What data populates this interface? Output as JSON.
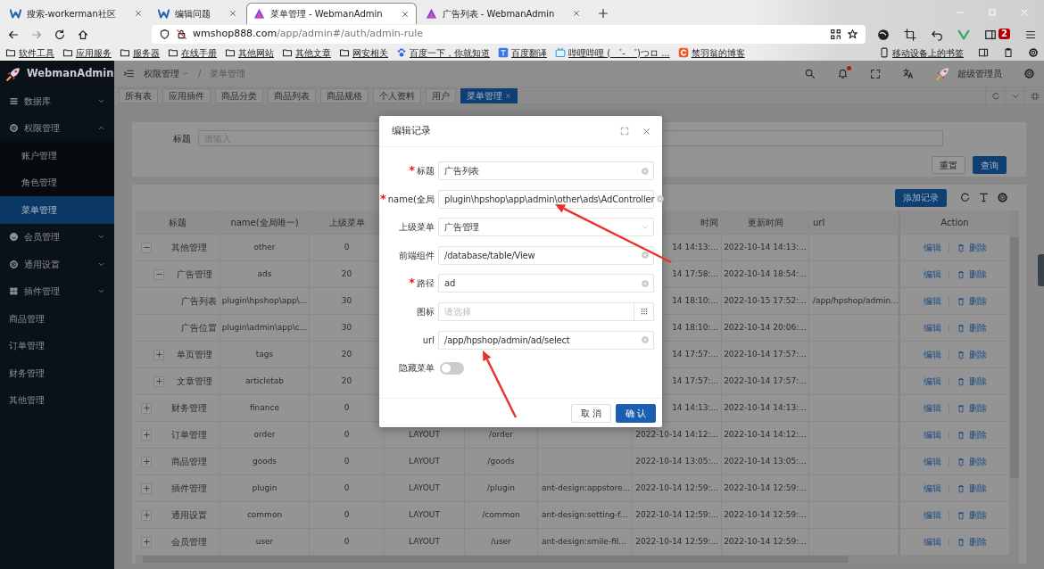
{
  "browser": {
    "tabs": [
      {
        "label": "搜索-workerman社区",
        "selected": false
      },
      {
        "label": "编辑问题",
        "selected": false
      },
      {
        "label": "菜单管理 - WebmanAdmin",
        "selected": true
      },
      {
        "label": "广告列表 - WebmanAdmin",
        "selected": false
      }
    ],
    "address": {
      "host": "wmshop888.com",
      "path": "/app/admin#/auth/admin-rule"
    },
    "extension_badge": "2",
    "bookmarks": [
      {
        "kind": "folder",
        "label": "软件工具"
      },
      {
        "kind": "folder",
        "label": "应用服务"
      },
      {
        "kind": "folder",
        "label": "服务器"
      },
      {
        "kind": "folder",
        "label": "在线手册"
      },
      {
        "kind": "folder",
        "label": "其他网站"
      },
      {
        "kind": "folder",
        "label": "其他文章"
      },
      {
        "kind": "folder",
        "label": "网安相关"
      },
      {
        "kind": "site",
        "label": "百度一下，你就知道"
      },
      {
        "kind": "site",
        "label": "百度翻译"
      },
      {
        "kind": "site",
        "label": "哔哩哔哩 ( ゜- ゜)つロ ..."
      },
      {
        "kind": "site",
        "label": "禁羽翁的博客"
      }
    ],
    "mobile_bookmarks": "移动设备上的书签"
  },
  "app": {
    "logo": "WebmanAdmin",
    "sidebar": [
      {
        "label": "数据库",
        "expandable": true,
        "expanded": false
      },
      {
        "label": "权限管理",
        "expandable": true,
        "expanded": true,
        "children": [
          {
            "label": "账户管理",
            "selected": false
          },
          {
            "label": "角色管理",
            "selected": false
          },
          {
            "label": "菜单管理",
            "selected": true
          }
        ]
      },
      {
        "label": "会员管理",
        "expandable": true,
        "expanded": false
      },
      {
        "label": "通用设置",
        "expandable": true,
        "expanded": false
      },
      {
        "label": "插件管理",
        "expandable": true,
        "expanded": false
      },
      {
        "label": "商品管理",
        "expandable": false
      },
      {
        "label": "订单管理",
        "expandable": false
      },
      {
        "label": "财务管理",
        "expandable": false
      },
      {
        "label": "其他管理",
        "expandable": false
      }
    ],
    "breadcrumb": {
      "items": [
        "权限管理",
        "菜单管理"
      ],
      "separator": "/"
    },
    "header": {
      "notification_dot": true,
      "user": "超级管理员"
    },
    "page_tabs": [
      {
        "label": "所有表",
        "selected": false
      },
      {
        "label": "应用插件",
        "selected": false
      },
      {
        "label": "商品分类",
        "selected": false
      },
      {
        "label": "商品列表",
        "selected": false
      },
      {
        "label": "商品规格",
        "selected": false
      },
      {
        "label": "个人资料",
        "selected": false
      },
      {
        "label": "用户",
        "selected": false
      },
      {
        "label": "菜单管理",
        "selected": true
      }
    ],
    "search": {
      "label": "标题",
      "placeholder": "请输入",
      "buttons": [
        "重置",
        "查询"
      ]
    },
    "table": {
      "add_button": "添加记录",
      "columns": [
        {
          "label": "标题"
        },
        {
          "label": "name(全局唯一)"
        },
        {
          "label": "上级菜单"
        },
        {},
        {},
        {},
        {
          "label": "时间"
        },
        {
          "label": "更新时间"
        },
        {
          "label": "url"
        },
        {
          "label": "Action"
        }
      ],
      "rows": [
        {
          "title": "其他管理",
          "name": "other",
          "parent": "0",
          "created": "14 14:13:...",
          "updated": "2022-10-14 14:13:...",
          "actions": [
            "编辑",
            "删除"
          ],
          "expanded": true,
          "children": [
            {
              "title": "广告管理",
              "name": "ads",
              "parent": "20",
              "created": "14 17:58:...",
              "updated": "2022-10-14 18:54:...",
              "actions": [
                "编辑",
                "删除"
              ],
              "expanded": true,
              "children": [
                {
                  "title": "广告列表",
                  "name": "plugin\\hpshop\\app\\...",
                  "parent": "30",
                  "created": "14 18:10:...",
                  "updated": "2022-10-15 17:52:...",
                  "url": "/app/hpshop/admin...",
                  "actions": [
                    "编辑",
                    "删除"
                  ]
                },
                {
                  "title": "广告位置",
                  "name": "plugin\\admin\\app\\c...",
                  "parent": "30",
                  "created": "14 18:10:...",
                  "updated": "2022-10-14 20:06:...",
                  "actions": [
                    "编辑",
                    "删除"
                  ]
                }
              ]
            },
            {
              "title": "单页管理",
              "name": "tags",
              "parent": "20",
              "created": "14 17:57:...",
              "updated": "2022-10-14 17:57:...",
              "actions": [
                "编辑",
                "删除"
              ],
              "expanded": false
            },
            {
              "title": "文章管理",
              "name": "articletab",
              "parent": "20",
              "created": "14 17:57:...",
              "updated": "2022-10-14 17:57:...",
              "actions": [
                "编辑",
                "删除"
              ],
              "expanded": false
            }
          ]
        },
        {
          "title": "财务管理",
          "name": "finance",
          "parent": "0",
          "created": "14 14:13:...",
          "updated": "2022-10-14 14:13:...",
          "actions": [
            "编辑",
            "删除"
          ],
          "expanded": false
        },
        {
          "title": "订单管理",
          "name": "order",
          "parent": "0",
          "type": "LAYOUT",
          "path": "/order",
          "created": "2022-10-14 14:12:...",
          "updated": "2022-10-14 14:12:...",
          "actions": [
            "编辑",
            "删除"
          ],
          "expanded": false
        },
        {
          "title": "商品管理",
          "name": "goods",
          "parent": "0",
          "type": "LAYOUT",
          "path": "/goods",
          "created": "2022-10-14 13:05:...",
          "updated": "2022-10-14 13:05:...",
          "actions": [
            "编辑",
            "删除"
          ],
          "expanded": false
        },
        {
          "title": "插件管理",
          "name": "plugin",
          "parent": "0",
          "type": "LAYOUT",
          "path": "/plugin",
          "icon": "ant-design:appstore...",
          "created": "2022-10-14 12:59:...",
          "updated": "2022-10-14 12:59:...",
          "actions": [
            "编辑",
            "删除"
          ],
          "expanded": false
        },
        {
          "title": "通用设置",
          "name": "common",
          "parent": "0",
          "type": "LAYOUT",
          "path": "/common",
          "icon": "ant-design:setting-f...",
          "created": "2022-10-14 12:59:...",
          "updated": "2022-10-14 12:59:...",
          "actions": [
            "编辑",
            "删除"
          ],
          "expanded": false
        },
        {
          "title": "会员管理",
          "name": "user",
          "parent": "0",
          "type": "LAYOUT",
          "path": "/user",
          "icon": "ant-design:smile-fil...",
          "created": "2022-10-14 12:59:...",
          "updated": "2022-10-14 12:59:...",
          "actions": [
            "编辑",
            "删除"
          ],
          "expanded": false
        }
      ]
    },
    "modal": {
      "title": "编辑记录",
      "required_mark": "*",
      "fields": [
        {
          "kind": "text",
          "label": "标题",
          "required": true,
          "value": "广告列表"
        },
        {
          "kind": "text",
          "label": "name(全局",
          "required": true,
          "value": "plugin\\hpshop\\app\\admin\\other\\ads\\AdController"
        },
        {
          "kind": "select",
          "label": "上级菜单",
          "required": false,
          "value": "广告管理"
        },
        {
          "kind": "text",
          "label": "前端组件",
          "required": false,
          "value": "/database/table/View"
        },
        {
          "kind": "text",
          "label": "路径",
          "required": true,
          "value": "ad"
        },
        {
          "kind": "icon_picker",
          "label": "图标",
          "required": false,
          "placeholder": "请选择"
        },
        {
          "kind": "text",
          "label": "url",
          "required": false,
          "value": "/app/hpshop/admin/ad/select"
        },
        {
          "kind": "toggle",
          "label": "隐藏菜单",
          "required": false,
          "on": false
        }
      ],
      "buttons": [
        "取 消",
        "确 认"
      ]
    }
  }
}
